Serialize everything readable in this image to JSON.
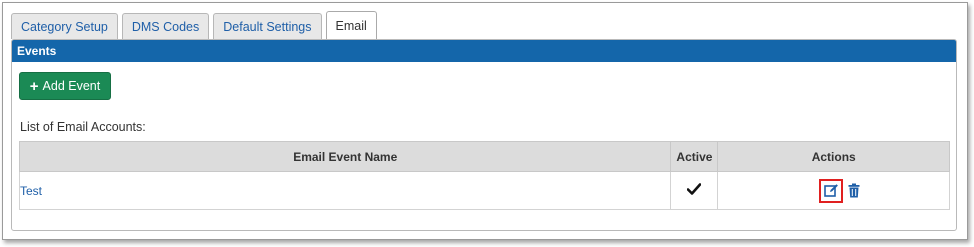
{
  "tabs": [
    {
      "label": "Category Setup",
      "active": false
    },
    {
      "label": "DMS Codes",
      "active": false
    },
    {
      "label": "Default Settings",
      "active": false
    },
    {
      "label": "Email",
      "active": true
    }
  ],
  "panel": {
    "title": "Events",
    "add_button_label": "Add Event",
    "add_button_icon": "plus-icon",
    "list_label": "List of Email Accounts:"
  },
  "table": {
    "columns": [
      "Email Event Name",
      "Active",
      "Actions"
    ],
    "rows": [
      {
        "name": "Test",
        "active": true,
        "active_icon": "checkmark-icon",
        "actions": [
          "edit-icon",
          "trash-icon"
        ]
      }
    ]
  },
  "colors": {
    "header_blue": "#1466aa",
    "add_button_green": "#1b8a55",
    "link_blue": "#1f5fa8",
    "highlight_red": "#e02020"
  }
}
